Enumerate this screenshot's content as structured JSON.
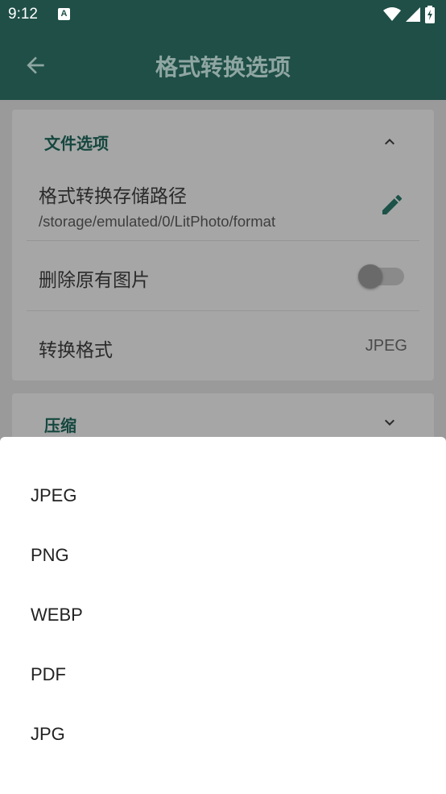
{
  "status_bar": {
    "time": "9:12",
    "notification_letter": "A"
  },
  "app_bar": {
    "title": "格式转换选项"
  },
  "file_section": {
    "title": "文件选项",
    "storage_path_title": "格式转换存储路径",
    "storage_path_value": "/storage/emulated/0/LitPhoto/format",
    "delete_original_title": "删除原有图片",
    "delete_original_enabled": false,
    "convert_format_title": "转换格式",
    "convert_format_value": "JPEG"
  },
  "compress_section": {
    "title": "压缩"
  },
  "format_sheet": {
    "options": [
      "JPEG",
      "PNG",
      "WEBP",
      "PDF",
      "JPG"
    ]
  },
  "colors": {
    "primary_dark": "#1f4f47",
    "accent": "#15473f"
  }
}
